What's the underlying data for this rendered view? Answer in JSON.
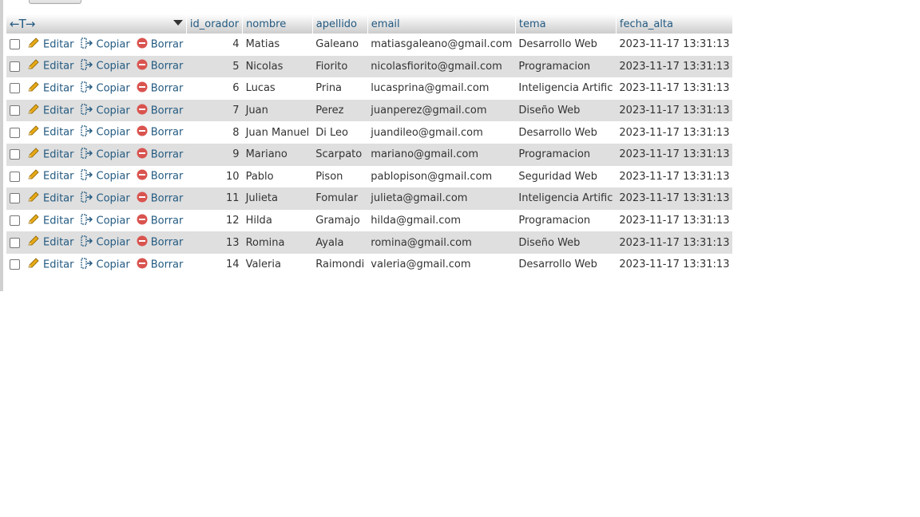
{
  "header": {
    "nav_arrows": "←T→",
    "columns": [
      "id_orador",
      "nombre",
      "apellido",
      "email",
      "tema",
      "fecha_alta"
    ]
  },
  "actions": {
    "edit_label": "Editar",
    "copy_label": "Copiar",
    "delete_label": "Borrar"
  },
  "rows": [
    {
      "id": "4",
      "nombre": "Matias",
      "apellido": "Galeano",
      "email": "matiasgaleano@gmail.com",
      "tema": "Desarrollo Web",
      "fecha_alta": "2023-11-17 13:31:13"
    },
    {
      "id": "5",
      "nombre": "Nicolas",
      "apellido": "Fiorito",
      "email": "nicolasfiorito@gmail.com",
      "tema": "Programacion",
      "fecha_alta": "2023-11-17 13:31:13"
    },
    {
      "id": "6",
      "nombre": "Lucas",
      "apellido": "Prina",
      "email": "lucasprina@gmail.com",
      "tema": "Inteligencia Artific",
      "fecha_alta": "2023-11-17 13:31:13"
    },
    {
      "id": "7",
      "nombre": "Juan",
      "apellido": "Perez",
      "email": "juanperez@gmail.com",
      "tema": "Diseño Web",
      "fecha_alta": "2023-11-17 13:31:13"
    },
    {
      "id": "8",
      "nombre": "Juan Manuel",
      "apellido": "Di Leo",
      "email": "juandileo@gmail.com",
      "tema": "Desarrollo Web",
      "fecha_alta": "2023-11-17 13:31:13"
    },
    {
      "id": "9",
      "nombre": "Mariano",
      "apellido": "Scarpato",
      "email": "mariano@gmail.com",
      "tema": "Programacion",
      "fecha_alta": "2023-11-17 13:31:13"
    },
    {
      "id": "10",
      "nombre": "Pablo",
      "apellido": "Pison",
      "email": "pablopison@gmail.com",
      "tema": "Seguridad Web",
      "fecha_alta": "2023-11-17 13:31:13"
    },
    {
      "id": "11",
      "nombre": "Julieta",
      "apellido": "Fomular",
      "email": "julieta@gmail.com",
      "tema": "Inteligencia Artific",
      "fecha_alta": "2023-11-17 13:31:13"
    },
    {
      "id": "12",
      "nombre": "Hilda",
      "apellido": "Gramajo",
      "email": "hilda@gmail.com",
      "tema": "Programacion",
      "fecha_alta": "2023-11-17 13:31:13"
    },
    {
      "id": "13",
      "nombre": "Romina",
      "apellido": "Ayala",
      "email": "romina@gmail.com",
      "tema": "Diseño Web",
      "fecha_alta": "2023-11-17 13:31:13"
    },
    {
      "id": "14",
      "nombre": "Valeria",
      "apellido": "Raimondi",
      "email": "valeria@gmail.com",
      "tema": "Desarrollo Web",
      "fecha_alta": "2023-11-17 13:31:13"
    }
  ],
  "colors": {
    "link": "#235a81",
    "row_alt": "#dfdfdf",
    "delete_icon": "#d9534f",
    "edit_icon": "#e6a817"
  },
  "icons": {
    "edit": "pencil-icon",
    "copy": "copy-icon",
    "delete": "delete-icon"
  }
}
